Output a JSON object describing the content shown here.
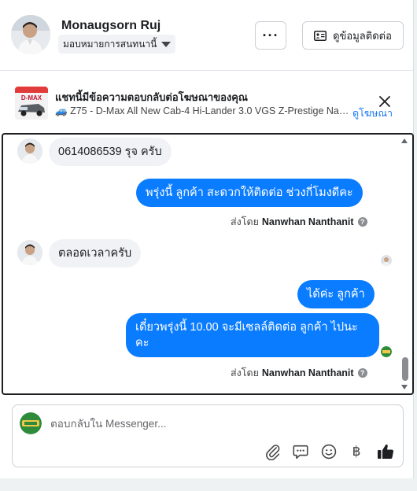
{
  "header": {
    "contact_name": "Monaugsorn Ruj",
    "assign_label": "มอบหมายการสนทนานี้",
    "more_label": "···",
    "contact_info_label": "ดูข้อมูลติดต่อ"
  },
  "ad_context": {
    "title": "แชทนี้มีข้อความตอบกลับต่อโฆษณาของคุณ",
    "car_emoji": "🚙",
    "subtitle": "Z75 - D-Max All New Cab-4 Hi-Lander 3.0 VGS Z-Prestige Navi...",
    "link": "ดูโฆษณา",
    "thumb_text": "D-MAX"
  },
  "messages": [
    {
      "direction": "in",
      "text": "0614086539 รุจ ครับ"
    },
    {
      "direction": "out",
      "text": "พรุ่งนี้ ลูกค้า  สะดวกให้ติดต่อ ช่วงกี่โมงดีคะ"
    },
    {
      "direction": "in",
      "text": "ตลอดเวลาครับ"
    },
    {
      "direction": "out",
      "text": "ได้ค่ะ  ลูกค้า"
    },
    {
      "direction": "out",
      "text": "เดี๋ยวพรุ่งนี้ 10.00 จะมีเซลล์ติดต่อ ลูกค้า  ไปนะคะ"
    }
  ],
  "sent_by": {
    "prefix": "ส่งโดย",
    "name": "Nanwhan Nanthanit"
  },
  "composer": {
    "placeholder": "ตอบกลับใน Messenger..."
  },
  "toolbar": {
    "baht_symbol": "฿"
  },
  "colors": {
    "outgoing_bubble": "#0a7cff",
    "incoming_bubble": "#f0f2f5",
    "link": "#1877f2"
  }
}
